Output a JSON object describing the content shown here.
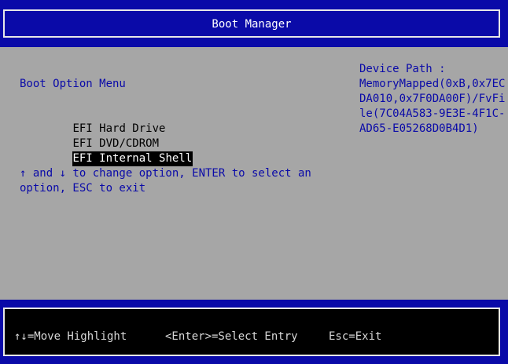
{
  "header": {
    "title": "Boot Manager"
  },
  "menu": {
    "title": "Boot Option Menu",
    "items": [
      {
        "label": "EFI Hard Drive",
        "selected": false
      },
      {
        "label": "EFI DVD/CDROM",
        "selected": false
      },
      {
        "label": "EFI Internal Shell",
        "selected": true
      }
    ],
    "help": "↑ and ↓ to change option, ENTER to select an option, ESC to exit"
  },
  "device_path": {
    "label": "Device Path :",
    "lines": [
      "MemoryMapped(0xB,0x7EC",
      "DA010,0x7F0DA00F)/FvFi",
      "le(7C04A583-9E3E-4F1C-",
      "AD65-E05268D0B4D1)"
    ]
  },
  "footer": {
    "move": "↑↓=Move Highlight",
    "enter": "<Enter>=Select Entry",
    "esc": "Esc=Exit"
  },
  "colors": {
    "blue": "#0a0aa8",
    "grey": "#a6a6a6",
    "black": "#000000",
    "white": "#ffffff"
  }
}
